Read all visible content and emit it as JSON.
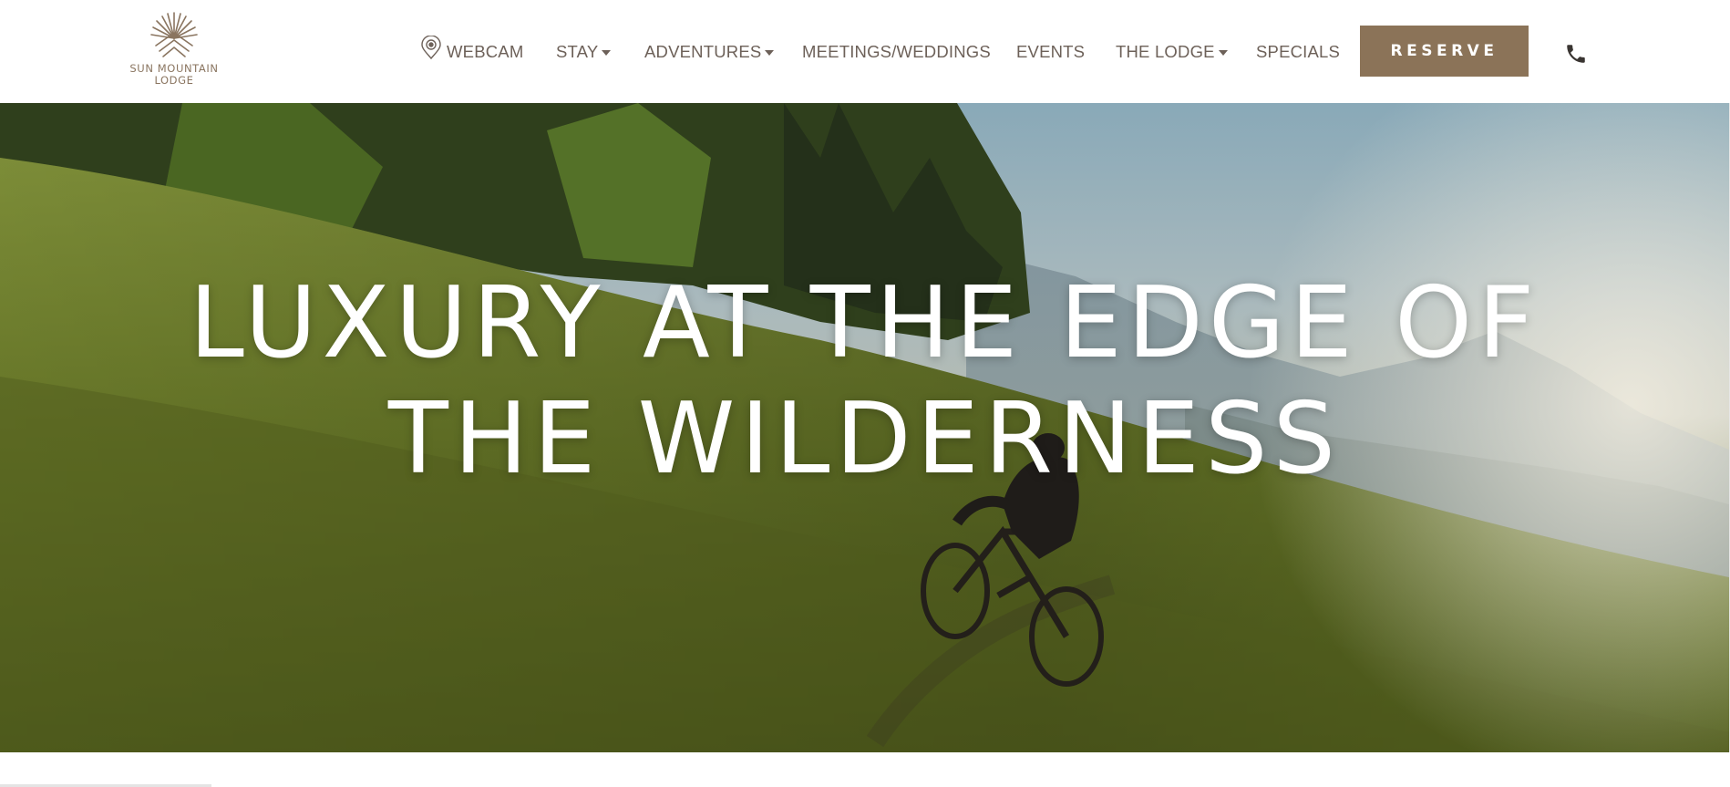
{
  "brand": {
    "name_line1": "SUN MOUNTAIN",
    "name_line2": "LODGE",
    "logo_icon": "sun-ray-logo-icon",
    "color": "#8a7560"
  },
  "nav": {
    "webcam": {
      "label": "WEBCAM",
      "icon": "webcam-pin-icon"
    },
    "stay": {
      "label": "STAY",
      "has_dropdown": true
    },
    "adventures": {
      "label": "ADVENTURES",
      "has_dropdown": true
    },
    "meetings": {
      "label": "MEETINGS/WEDDINGS"
    },
    "events": {
      "label": "EVENTS"
    },
    "lodge": {
      "label": "THE LODGE",
      "has_dropdown": true
    },
    "specials": {
      "label": "SPECIALS"
    },
    "reserve_label": "RESERVE",
    "phone_icon": "phone-icon",
    "text_color": "#6d6159",
    "accent": "#8b7358"
  },
  "hero": {
    "title_line1": "LUXURY AT THE EDGE OF",
    "title_line2": "THE WILDERNESS",
    "image": "mountain-biker-on-grassy-hillside"
  }
}
